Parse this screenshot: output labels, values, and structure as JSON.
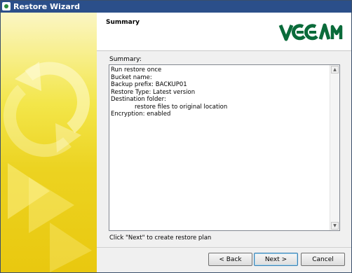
{
  "window": {
    "title": "Restore Wizard"
  },
  "header": {
    "title": "Summary",
    "logo_text": "VEEAM"
  },
  "content": {
    "label": "Summary:",
    "lines": [
      "Run restore once",
      "Bucket name:",
      "Backup prefix: BACKUP01",
      "Restore Type: Latest version",
      "Destination folder:",
      "restore files to original location",
      "Encryption: enabled"
    ],
    "hint": "Click \"Next\" to create restore plan"
  },
  "footer": {
    "back_label": "< Back",
    "next_label": "Next >",
    "cancel_label": "Cancel"
  },
  "colors": {
    "titlebar": "#2b4f8a",
    "banner_yellow": "#ecd321",
    "logo_green": "#0a6b3a"
  }
}
